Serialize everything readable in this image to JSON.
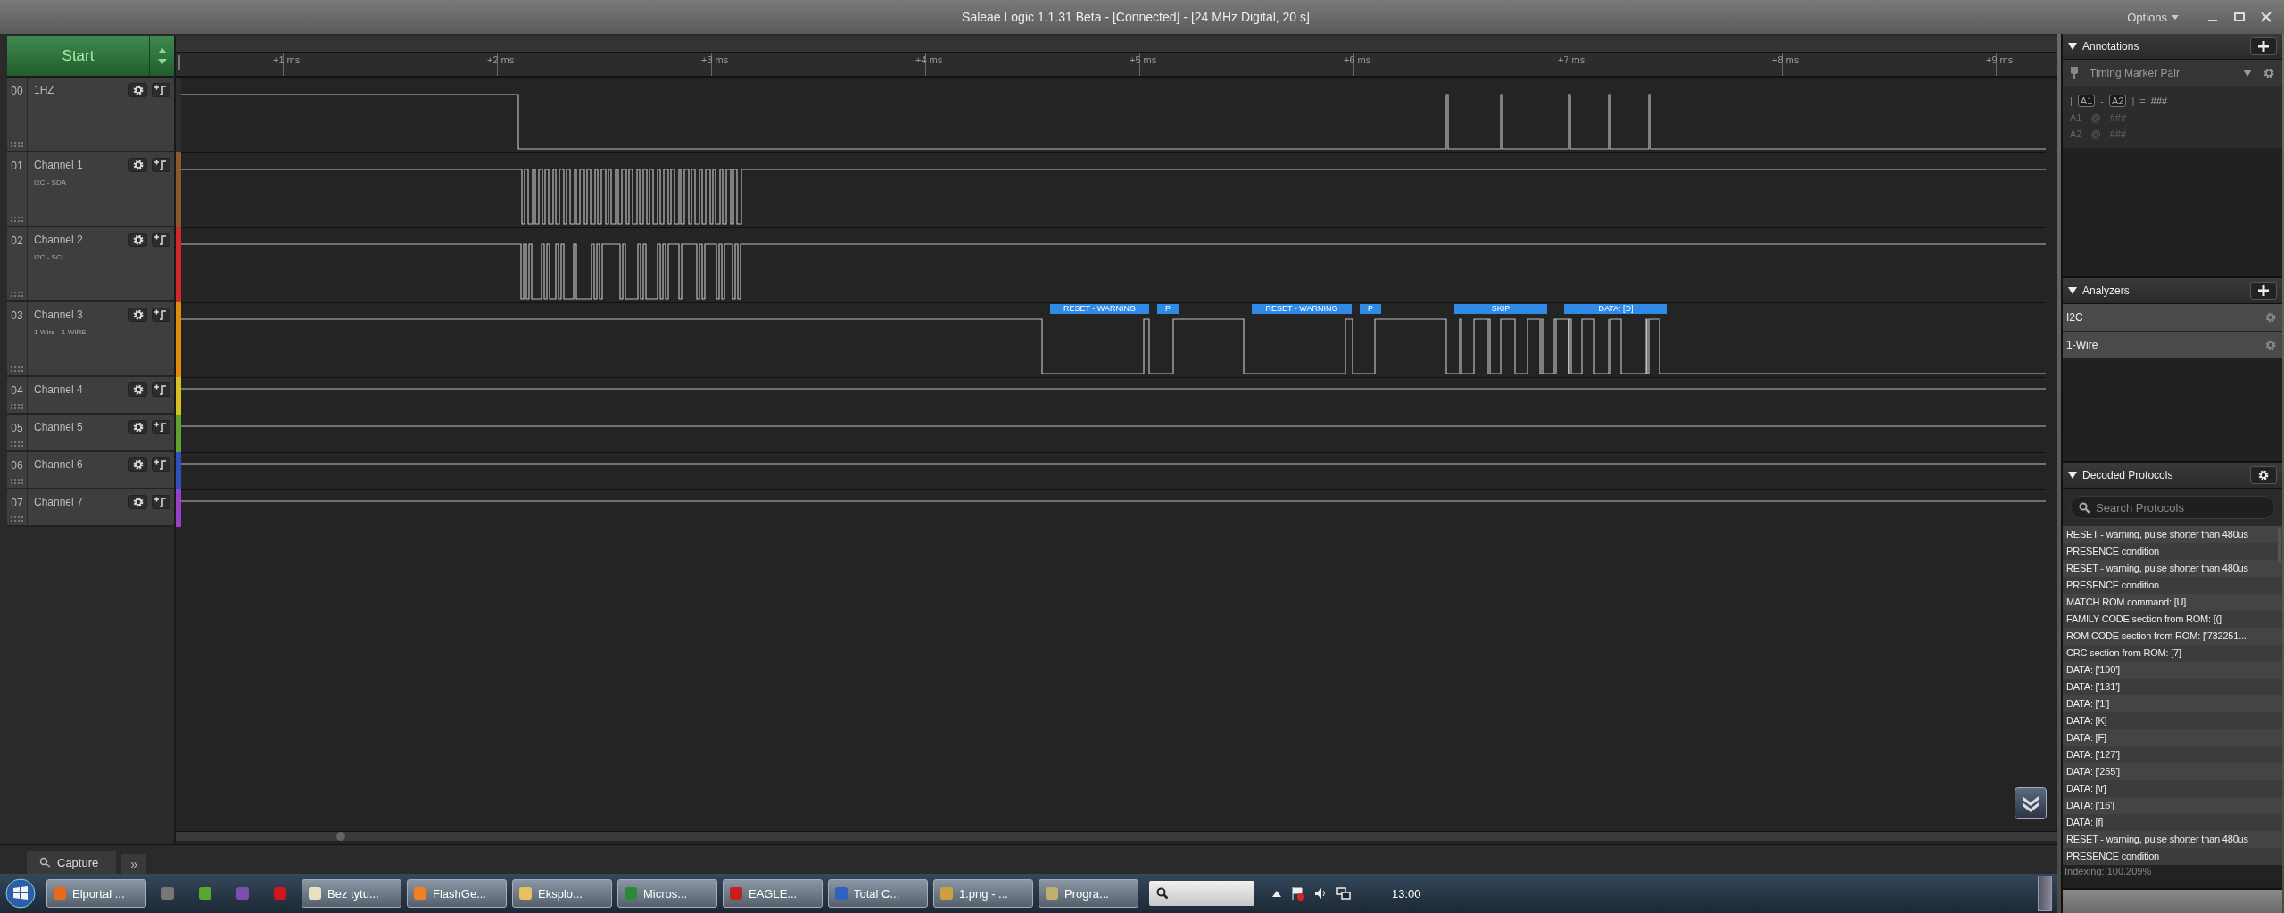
{
  "window": {
    "title": "Saleae Logic 1.1.31 Beta - [Connected] - [24 MHz Digital, 20 s]",
    "options": "Options"
  },
  "start_button": {
    "label": "Start"
  },
  "ruler": {
    "ticks": [
      "+1 ms",
      "+2 ms",
      "+3 ms",
      "+4 ms",
      "+5 ms",
      "+6 ms",
      "+7 ms",
      "+8 ms",
      "+9 ms"
    ]
  },
  "channels": [
    {
      "number": "00",
      "name": "1HZ",
      "color": "#2e2e2e",
      "tall": true
    },
    {
      "number": "01",
      "name": "Channel 1",
      "subtitle": "I2C - SDA",
      "color": "#8a5a2e",
      "tall": true
    },
    {
      "number": "02",
      "name": "Channel 2",
      "subtitle": "I2C - SCL",
      "color": "#d02828",
      "tall": true
    },
    {
      "number": "03",
      "name": "Channel 3",
      "subtitle": "1-Wire - 1-WIRE",
      "color": "#e08a10",
      "tall": true,
      "frames": [
        {
          "text": "RESET - WARNING"
        },
        {
          "text": "P"
        },
        {
          "text": "RESET - WARNING"
        },
        {
          "text": "P"
        },
        {
          "text": "SKIP"
        },
        {
          "text": "DATA: [D]"
        }
      ]
    },
    {
      "number": "04",
      "name": "Channel 4",
      "color": "#d8c020",
      "tall": false
    },
    {
      "number": "05",
      "name": "Channel 5",
      "color": "#60a030",
      "tall": false
    },
    {
      "number": "06",
      "name": "Channel 6",
      "color": "#3050c0",
      "tall": false
    },
    {
      "number": "07",
      "name": "Channel 7",
      "color": "#9a40c8",
      "tall": false
    }
  ],
  "bottom_tabs": [
    {
      "label": "Capture"
    }
  ],
  "more": "»",
  "annotations": {
    "title": "Annotations",
    "marker": "Timing Marker Pair",
    "formula": {
      "open": "|",
      "a": "A1",
      "minus": "-",
      "b": "A2",
      "close": "|",
      "equals": "=",
      "value": "###"
    },
    "markers": [
      {
        "label": "A1",
        "at": "@",
        "value": "###"
      },
      {
        "label": "A2",
        "at": "@",
        "value": "###"
      }
    ]
  },
  "analyzers": {
    "title": "Analyzers",
    "items": [
      {
        "name": "I2C"
      },
      {
        "name": "1-Wire"
      }
    ]
  },
  "decoded": {
    "title": "Decoded Protocols",
    "placeholder": "Search Protocols",
    "rows": [
      "RESET - warning, pulse shorter than 480us",
      "PRESENCE condition",
      "RESET - warning, pulse shorter than 480us",
      "PRESENCE condition",
      "MATCH ROM command: [U]",
      "FAMILY CODE section from ROM: [(]",
      "ROM CODE section from ROM: ['732251...",
      "CRC section from ROM: [7]",
      "DATA: ['190']",
      "DATA: ['131']",
      "DATA: ['1']",
      "DATA: [K]",
      "DATA: [F]",
      "DATA: ['127']",
      "DATA: ['255']",
      "DATA: [\\r]",
      "DATA: ['16']",
      "DATA: [f]",
      "RESET - warning, pulse shorter than 480us",
      "PRESENCE condition"
    ],
    "status": "Indexing: 100.209%"
  },
  "taskbar": {
    "items": [
      {
        "kind": "window",
        "label": "Elportal ..."
      },
      {
        "kind": "pinned"
      },
      {
        "kind": "pinned"
      },
      {
        "kind": "pinned"
      },
      {
        "kind": "pinned"
      },
      {
        "kind": "window",
        "label": "Bez tytu..."
      },
      {
        "kind": "window",
        "label": "FlashGe..."
      },
      {
        "kind": "window",
        "label": "Eksplo..."
      },
      {
        "kind": "window",
        "label": "Micros..."
      },
      {
        "kind": "window",
        "label": "EAGLE..."
      },
      {
        "kind": "window",
        "label": "Total C..."
      },
      {
        "kind": "window",
        "label": "1.png - ..."
      },
      {
        "kind": "window",
        "label": "Progra..."
      }
    ],
    "clock": "13:00"
  }
}
